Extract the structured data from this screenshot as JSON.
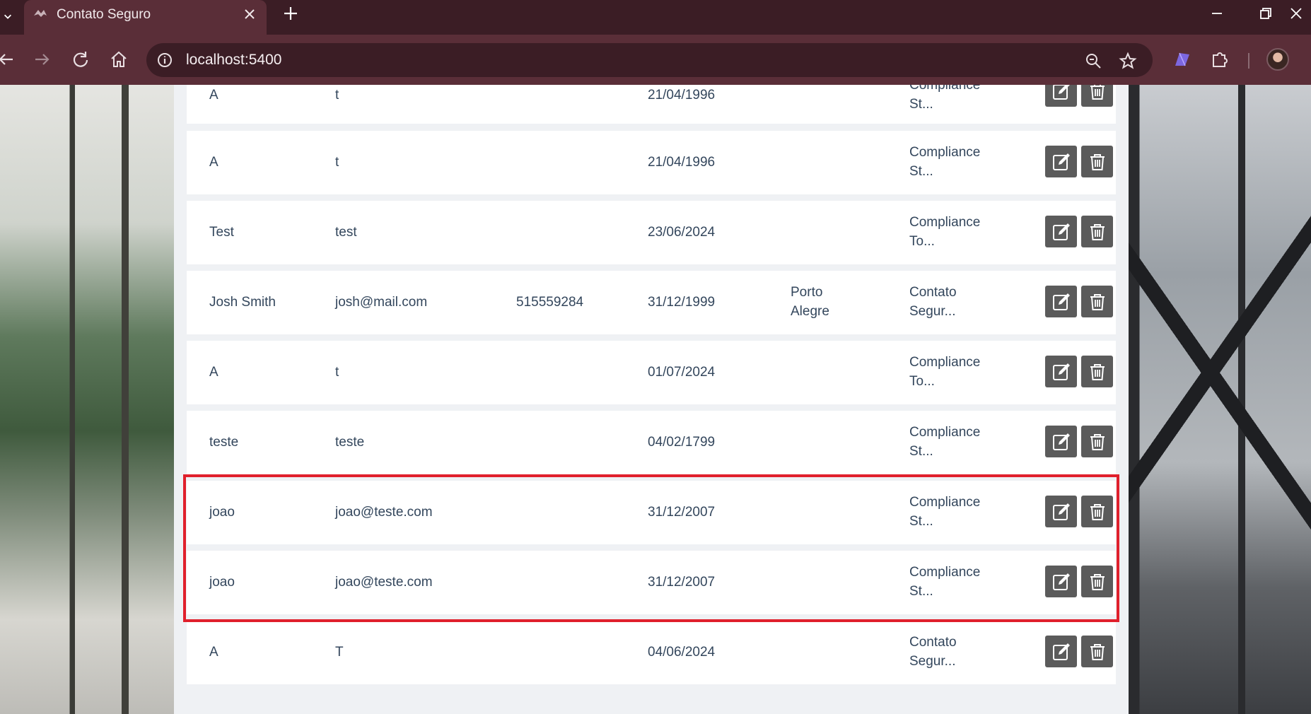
{
  "browser": {
    "tab_title": "Contato Seguro",
    "url": "localhost:5400",
    "icons": [
      "tab-dropdown-icon",
      "favicon-icon",
      "close-icon",
      "plus-icon",
      "minimize-icon",
      "restore-icon",
      "close-window-icon",
      "back-icon",
      "forward-icon",
      "reload-icon",
      "home-icon",
      "info-icon",
      "zoom-icon",
      "star-icon",
      "extension-icon",
      "puzzle-icon"
    ]
  },
  "rows": [
    {
      "name": "A",
      "email": "t",
      "phone": "",
      "date": "21/04/1996",
      "city": "",
      "company": [
        "Compliance",
        "St..."
      ]
    },
    {
      "name": "A",
      "email": "t",
      "phone": "",
      "date": "21/04/1996",
      "city": "",
      "company": [
        "Compliance",
        "St..."
      ]
    },
    {
      "name": "Test",
      "email": "test",
      "phone": "",
      "date": "23/06/2024",
      "city": "",
      "company": [
        "Compliance",
        "To..."
      ]
    },
    {
      "name": "Josh Smith",
      "email": "josh@mail.com",
      "phone": "515559284",
      "date": "31/12/1999",
      "city": [
        "Porto",
        "Alegre"
      ],
      "company": [
        "Contato",
        "Segur..."
      ]
    },
    {
      "name": "A",
      "email": "t",
      "phone": "",
      "date": "01/07/2024",
      "city": "",
      "company": [
        "Compliance",
        "To..."
      ]
    },
    {
      "name": "teste",
      "email": "teste",
      "phone": "",
      "date": "04/02/1799",
      "city": "",
      "company": [
        "Compliance",
        "St..."
      ]
    },
    {
      "name": "joao",
      "email": "joao@teste.com",
      "phone": "",
      "date": "31/12/2007",
      "city": "",
      "company": [
        "Compliance",
        "St..."
      ]
    },
    {
      "name": "joao",
      "email": "joao@teste.com",
      "phone": "",
      "date": "31/12/2007",
      "city": "",
      "company": [
        "Compliance",
        "St..."
      ]
    },
    {
      "name": "A",
      "email": "T",
      "phone": "",
      "date": "04/06/2024",
      "city": "",
      "company": [
        "Contato",
        "Segur..."
      ]
    }
  ],
  "colors": {
    "highlight": "#e0202c",
    "action_button": "#5b5b5b",
    "text": "#33465c"
  },
  "row_actions": [
    "edit-icon",
    "trash-icon"
  ]
}
